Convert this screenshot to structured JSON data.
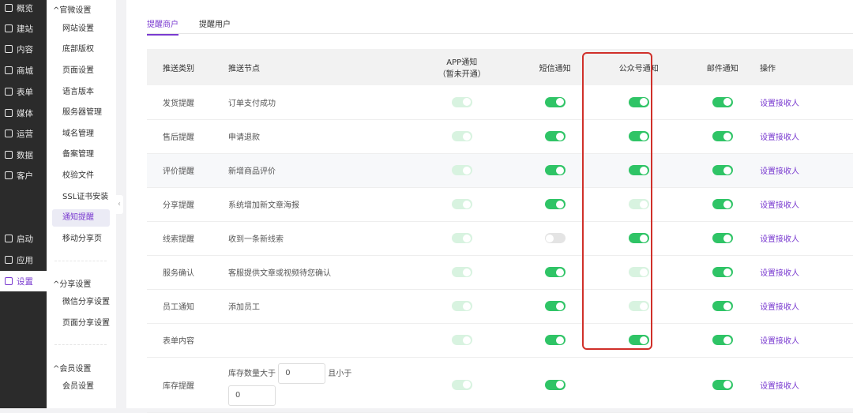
{
  "nav": [
    "概览",
    "建站",
    "内容",
    "商城",
    "表单",
    "媒体",
    "运营",
    "数据",
    "客户",
    "启动",
    "应用",
    "设置"
  ],
  "nav_icons": [
    "shop-icon",
    "home-icon",
    "document-icon",
    "store-icon",
    "form-icon",
    "video-icon",
    "paperclip-icon",
    "chart-icon",
    "user-icon",
    "launch-icon",
    "apps-icon",
    "gear-icon"
  ],
  "sub": {
    "groups": [
      {
        "title": "官微设置",
        "items": [
          "网站设置",
          "底部版权",
          "页面设置",
          "语言版本",
          "服务器管理",
          "域名管理",
          "备案管理",
          "校验文件",
          "SSL证书安装",
          "通知提醒",
          "移动分享页"
        ]
      },
      {
        "title": "分享设置",
        "items": [
          "微信分享设置",
          "页面分享设置"
        ]
      },
      {
        "title": "会员设置",
        "items": [
          "会员设置"
        ]
      }
    ]
  },
  "tabs": [
    "提醒商户",
    "提醒用户"
  ],
  "table": {
    "headers": [
      "推送类别",
      "推送节点",
      "APP通知",
      "（暂未开通）",
      "短信通知",
      "公众号通知",
      "邮件通知",
      "操作"
    ],
    "action": "设置接收人",
    "rows": [
      {
        "type": "发货提醒",
        "node": "订单支付成功",
        "app": "disabled",
        "sms": "on",
        "wx": "on",
        "mail": "on"
      },
      {
        "type": "售后提醒",
        "node": "申请退款",
        "app": "disabled",
        "sms": "on",
        "wx": "on",
        "mail": "on"
      },
      {
        "type": "评价提醒",
        "node": "新增商品评价",
        "app": "disabled",
        "sms": "on",
        "wx": "on",
        "mail": "on"
      },
      {
        "type": "分享提醒",
        "node": "系统增加新文章海报",
        "app": "disabled",
        "sms": "on",
        "wx": "disabled",
        "mail": "on"
      },
      {
        "type": "线索提醒",
        "node": "收到一条新线索",
        "app": "disabled",
        "sms": "off",
        "wx": "on",
        "mail": "on"
      },
      {
        "type": "服务确认",
        "node": "客服提供文章或视频待您确认",
        "app": "disabled",
        "sms": "on",
        "wx": "disabled",
        "mail": "on"
      },
      {
        "type": "员工通知",
        "node": "添加员工",
        "app": "disabled",
        "sms": "on",
        "wx": "disabled",
        "mail": "on"
      },
      {
        "type": "表单内容",
        "node": "",
        "app": "disabled",
        "sms": "on",
        "wx": "on",
        "mail": "on"
      }
    ],
    "stock": {
      "type": "库存提醒",
      "label1": "库存数量大于",
      "value1": "0",
      "label2": "且小于",
      "value2": "0",
      "app": "disabled",
      "sms": "on",
      "mail": "on"
    }
  }
}
